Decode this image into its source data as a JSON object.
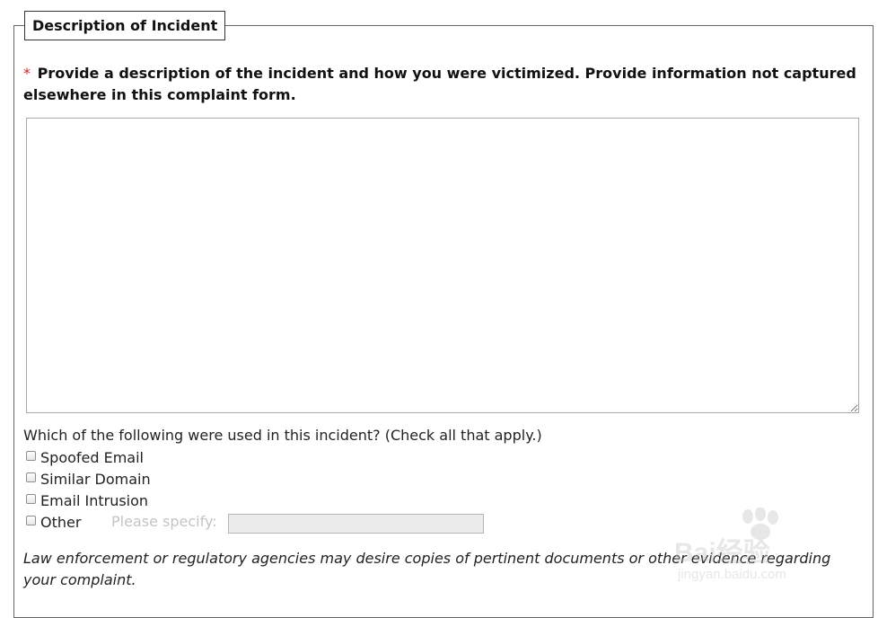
{
  "fieldset": {
    "legend": "Description of Incident"
  },
  "description": {
    "required_marker": "*",
    "prompt": "Provide a description of the incident and how you were victimized. Provide information not captured elsewhere in this complaint form.",
    "value": ""
  },
  "methods": {
    "question": "Which of the following were used in this incident? (Check all that apply.)",
    "options": [
      {
        "label": "Spoofed Email",
        "checked": false
      },
      {
        "label": "Similar Domain",
        "checked": false
      },
      {
        "label": "Email Intrusion",
        "checked": false
      },
      {
        "label": "Other",
        "checked": false
      }
    ],
    "specify_label": "Please specify:",
    "specify_value": ""
  },
  "note": "Law enforcement or regulatory agencies may desire copies of pertinent documents or other evidence regarding your complaint.",
  "watermark": {
    "brand": "Bai经验",
    "url": "jingyan.baidu.com"
  }
}
